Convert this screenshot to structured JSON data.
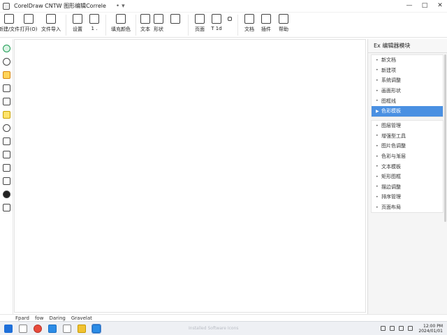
{
  "titlebar": {
    "title": "CorelDraw CNTW 图形编辑Correle",
    "extra": "•  ▾",
    "buttons": [
      "—",
      "□",
      "✕"
    ]
  },
  "ribbon": {
    "groups": [
      [
        {
          "icon": "new-doc-icon",
          "label": "新建/文件"
        },
        {
          "icon": "open-icon",
          "label": "打开(O)"
        },
        {
          "icon": "import-icon",
          "label": "文件导入"
        }
      ],
      [
        {
          "icon": "chart-icon",
          "label": "设置"
        },
        {
          "icon": "number-icon",
          "label": "1 ."
        }
      ],
      [
        {
          "icon": "fill-icon",
          "label": "填充颜色"
        }
      ],
      [
        {
          "icon": "shape-icon",
          "label": "文本"
        },
        {
          "icon": "arrow-icon",
          "label": "形状"
        },
        {
          "icon": "layout-icon",
          "label": ""
        }
      ],
      [
        {
          "icon": "bookmark-icon",
          "label": "页面"
        },
        {
          "icon": "star-icon",
          "label": "T 1d"
        },
        {
          "icon": "more-icon",
          "label": ""
        }
      ],
      [
        {
          "icon": "home-icon",
          "label": "文档"
        },
        {
          "icon": "bug-icon",
          "label": "插件"
        },
        {
          "icon": "user-icon",
          "label": "帮助"
        }
      ]
    ]
  },
  "left_tools": [
    "select-icon",
    "shape-edit-icon",
    "pen-icon",
    "text-icon",
    "crop-icon",
    "color-icon",
    "fill-icon",
    "eraser-icon",
    "table-icon",
    "link-icon",
    "layers-icon",
    "ink-icon",
    "grid-icon"
  ],
  "right_panel": {
    "header": "Ex 编辑器模块",
    "group1": [
      {
        "label": "新文档",
        "active": false
      },
      {
        "label": "新建项",
        "active": false
      },
      {
        "label": "系统调整",
        "active": false
      },
      {
        "label": "画面形状",
        "active": false
      },
      {
        "label": "图框线",
        "active": false
      },
      {
        "label": "色彩模板",
        "active": true
      }
    ],
    "group2": [
      {
        "label": "图层管理"
      },
      {
        "label": "增强型工具"
      },
      {
        "label": "图片色调整"
      },
      {
        "label": "色彩与渐层"
      },
      {
        "label": "文本模板"
      },
      {
        "label": "矩形图框"
      },
      {
        "label": "描边调整"
      },
      {
        "label": "排序管理"
      },
      {
        "label": "页面布局"
      }
    ]
  },
  "statusbar": {
    "items": [
      "Fpard",
      "fow",
      "Daring",
      "Gravelat"
    ]
  },
  "taskbar": {
    "center_text": "Installed Software Icons",
    "clock_time": "12:00 PM",
    "clock_date": "2024/01/01"
  }
}
